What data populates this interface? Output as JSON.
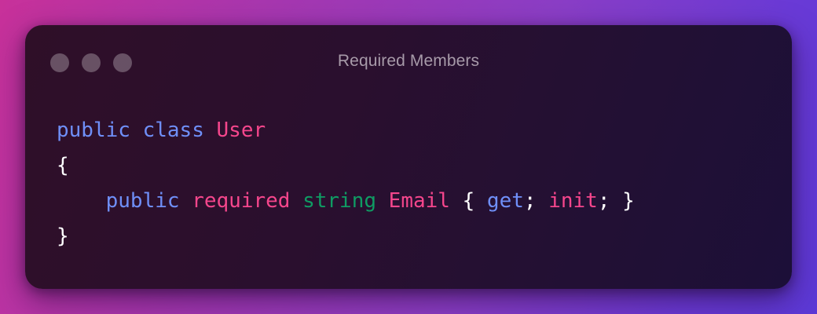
{
  "window": {
    "title": "Required Members"
  },
  "colors": {
    "keyword": "#6f8ff8",
    "identifier": "#f5468c",
    "type": "#0f9b63",
    "punctuation": "#ffffff"
  },
  "code": {
    "line1": {
      "kw1": "public",
      "kw2": "class",
      "class_name": "User"
    },
    "line2": {
      "open_brace": "{"
    },
    "line3": {
      "indent": "    ",
      "kw_public": "public",
      "modifier": "required",
      "type": "string",
      "property": "Email",
      "open_brace": "{",
      "getter": "get",
      "semicolon1": ";",
      "init": "init",
      "semicolon2": ";",
      "close_brace": "}"
    },
    "line4": {
      "close_brace": "}"
    }
  }
}
